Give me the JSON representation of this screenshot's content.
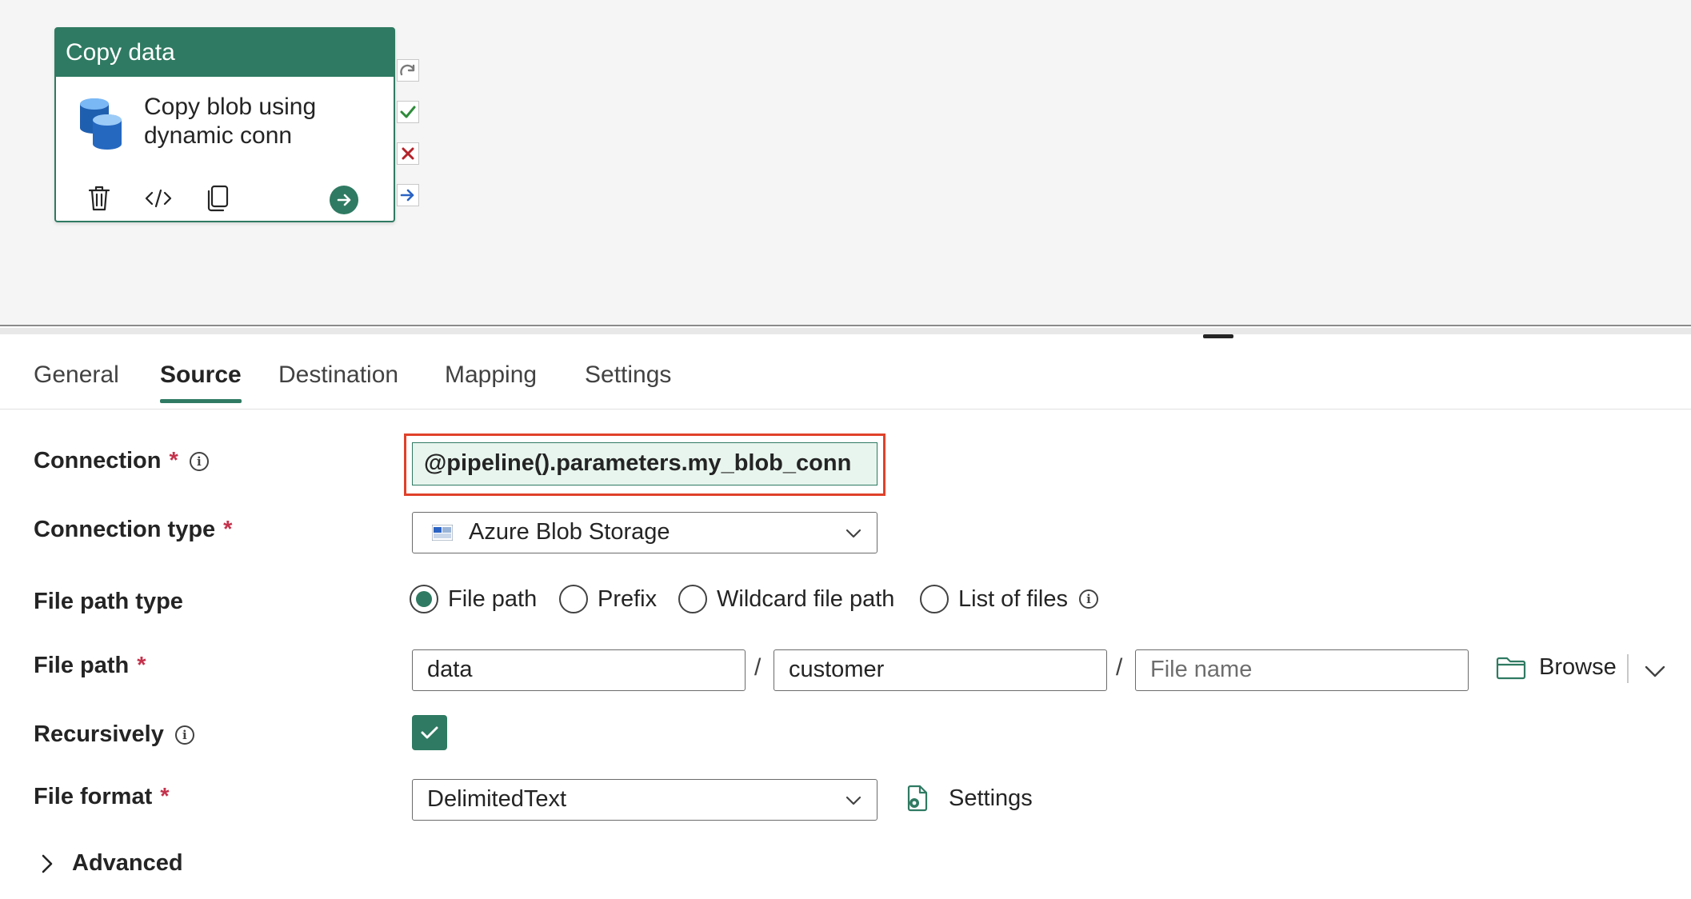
{
  "activity": {
    "type_label": "Copy data",
    "name": "Copy blob using dynamic conn"
  },
  "tabs": [
    {
      "label": "General",
      "active": false
    },
    {
      "label": "Source",
      "active": true
    },
    {
      "label": "Destination",
      "active": false
    },
    {
      "label": "Mapping",
      "active": false
    },
    {
      "label": "Settings",
      "active": false
    }
  ],
  "form": {
    "connection": {
      "label": "Connection",
      "required": "*",
      "info": "i",
      "value": "@pipeline().parameters.my_blob_conn"
    },
    "connection_type": {
      "label": "Connection type",
      "required": "*",
      "value": "Azure Blob Storage"
    },
    "file_path_type": {
      "label": "File path type",
      "options": [
        "File path",
        "Prefix",
        "Wildcard file path",
        "List of files"
      ],
      "selected": "File path",
      "info": "i"
    },
    "file_path": {
      "label": "File path",
      "required": "*",
      "container": "data",
      "directory": "customer",
      "file_name_placeholder": "File name",
      "separator": "/",
      "browse_label": "Browse"
    },
    "recursively": {
      "label": "Recursively",
      "info": "i",
      "checked": true
    },
    "file_format": {
      "label": "File format",
      "required": "*",
      "value": "DelimitedText",
      "settings_label": "Settings"
    },
    "advanced": {
      "label": "Advanced"
    }
  },
  "colors": {
    "accent": "#2f7a62",
    "required": "#c4314b",
    "highlight": "#e0412a"
  }
}
